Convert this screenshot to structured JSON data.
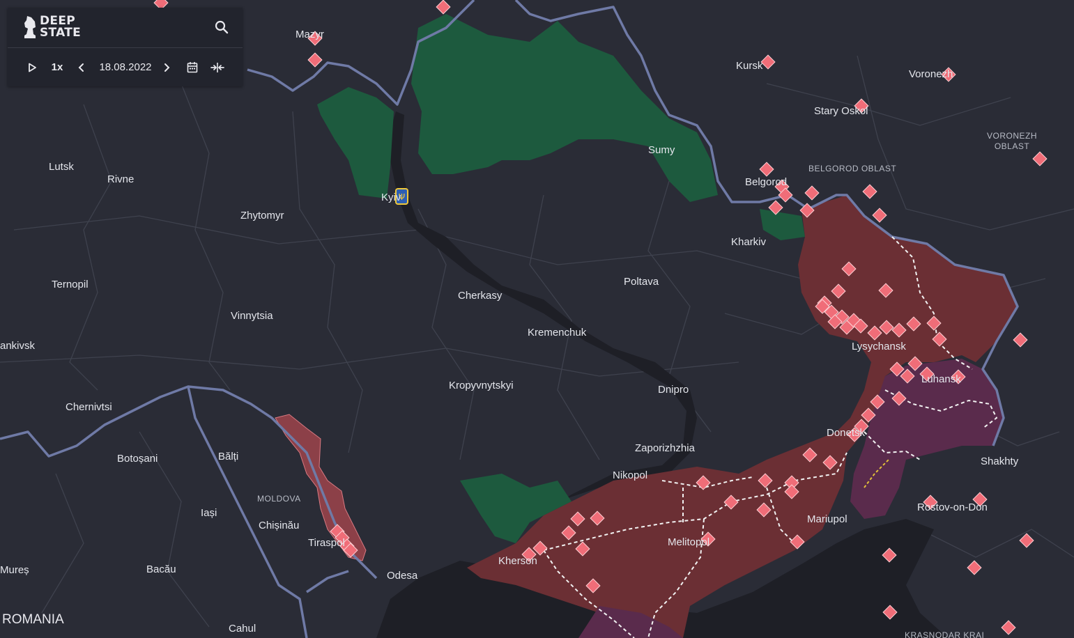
{
  "app": {
    "logo_line1": "DEEP",
    "logo_line2": "STATE"
  },
  "playback": {
    "speed": "1x",
    "date": "18.08.2022"
  },
  "labels": {
    "mazyr": "Mazyr",
    "kursk": "Kursk",
    "voronezh": "Voronezh",
    "stary_oskol": "Stary Oskol",
    "voronezh_oblast": [
      "VORONEZH",
      "OBLAST"
    ],
    "sumy": "Sumy",
    "belgorod": "Belgorod",
    "belgorod_oblast": "BELGOROD OBLAST",
    "lutsk": "Lutsk",
    "rivne": "Rivne",
    "zhytomyr": "Zhytomyr",
    "kyiv": "Kyiv",
    "kharkiv": "Kharkiv",
    "ternopil": "Ternopil",
    "poltava": "Poltava",
    "cherkasy": "Cherkasy",
    "vinnytsia": "Vinnytsia",
    "ivano_frankivsk": "ankivsk",
    "kremenchuk": "Kremenchuk",
    "lysychansk": "Lysychansk",
    "luhansk": "Luhansk",
    "chernivtsi": "Chernivtsi",
    "kropyvnytskyi": "Kropyvnytskyi",
    "dnipro": "Dnipro",
    "donetsk": "Donetsk",
    "zaporizhzhia": "Zaporizhzhia",
    "shakhty": "Shakhty",
    "botosani": "Botoșani",
    "balti": "Bălți",
    "nikopol": "Nikopol",
    "moldova": "MOLDOVA",
    "iasi": "Iași",
    "chisinau": "Chișinău",
    "mariupol": "Mariupol",
    "rostov": "Rostov-on-Don",
    "tiraspol": "Tiraspol",
    "melitopol": "Melitopol",
    "kherson": "Kherson",
    "mures": "Mureș",
    "bacau": "Bacău",
    "odesa": "Odesa",
    "romania": "ROMANIA",
    "cahul": "Cahul",
    "krasnodar": "KRASNODAR KRAI"
  },
  "colors": {
    "background": "#2a2c36",
    "occupied": "#6b2f34",
    "occupied_since_2014": "#5a2b4c",
    "liberated": "#1d5a3e",
    "transnistria": "#8c4048",
    "water": "#1e1f26",
    "border": "#6f7aa6",
    "markers": "#f06d78"
  }
}
